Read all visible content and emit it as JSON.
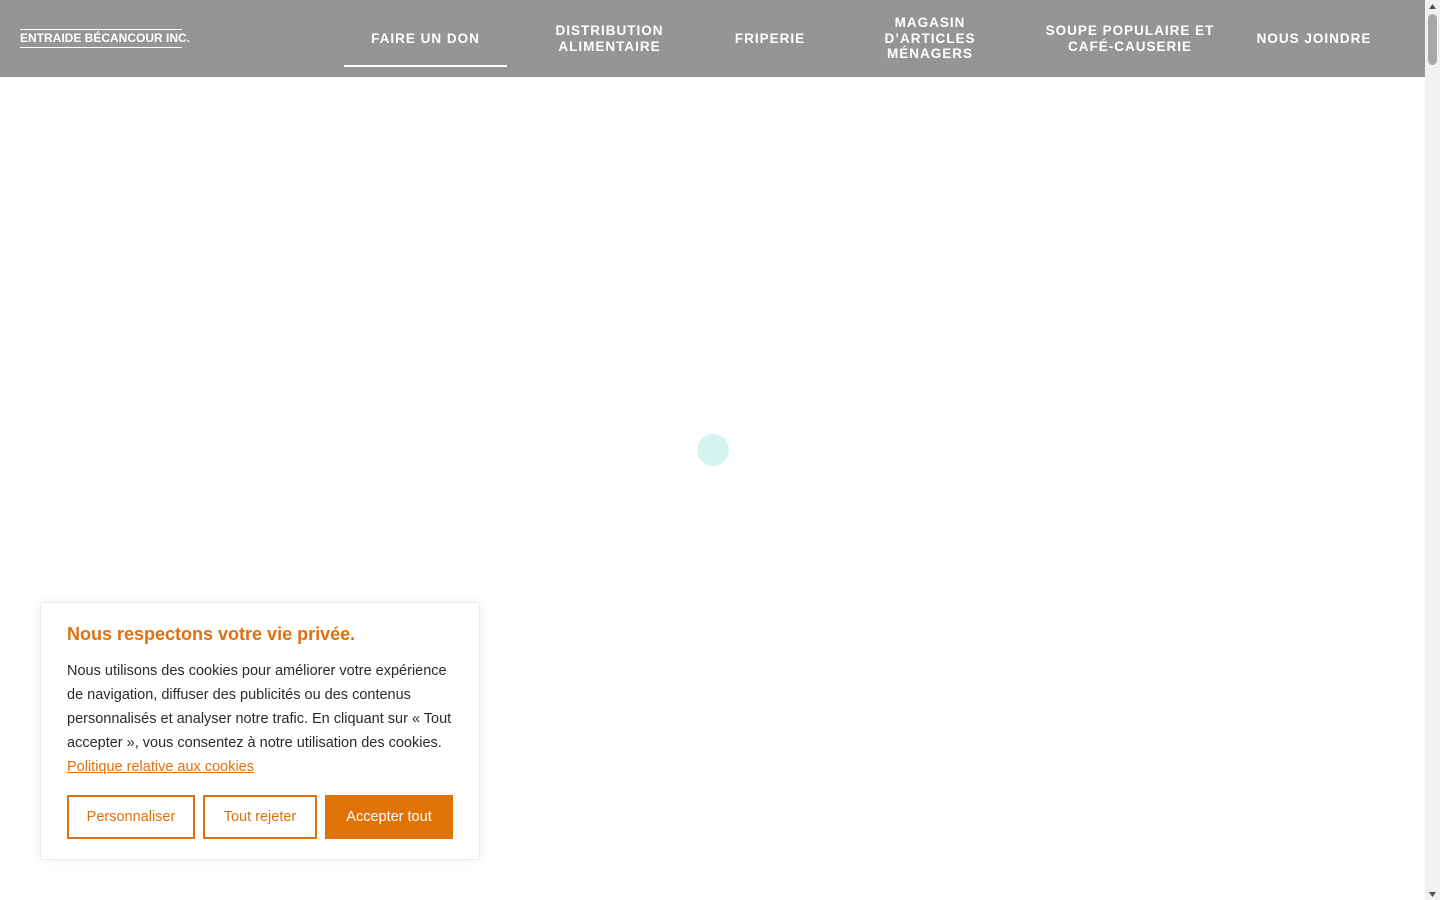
{
  "header": {
    "logo_text": "ENTRAIDE BÉCANCOUR INC.",
    "nav": [
      {
        "label": "FAIRE UN DON",
        "active": true
      },
      {
        "label": "DISTRIBUTION ALIMENTAIRE"
      },
      {
        "label": "FRIPERIE"
      },
      {
        "label": "MAGASIN D’ARTICLES MÉNAGERS"
      },
      {
        "label": "SOUPE POPULAIRE ET CAFÉ-CAUSERIE"
      },
      {
        "label": "NOUS JOINDRE"
      }
    ]
  },
  "cookie_banner": {
    "title": "Nous respectons votre vie privée.",
    "body": "Nous utilisons des cookies pour améliorer votre expérience de navigation, diffuser des publicités ou des contenus personnalisés et analyser notre trafic. En cliquant sur « Tout accepter », vous consentez à notre utilisation des cookies.",
    "policy_link": "Politique relative aux cookies",
    "buttons": {
      "customize": "Personnaliser",
      "reject": "Tout rejeter",
      "accept": "Accepter tout"
    }
  },
  "colors": {
    "header_bg": "#959595",
    "accent": "#e0700e",
    "loader": "#d4f5ef"
  },
  "icons": {
    "loader": "loading-spinner-icon",
    "scroll_up": "triangle-up-icon",
    "scroll_down": "triangle-down-icon"
  }
}
